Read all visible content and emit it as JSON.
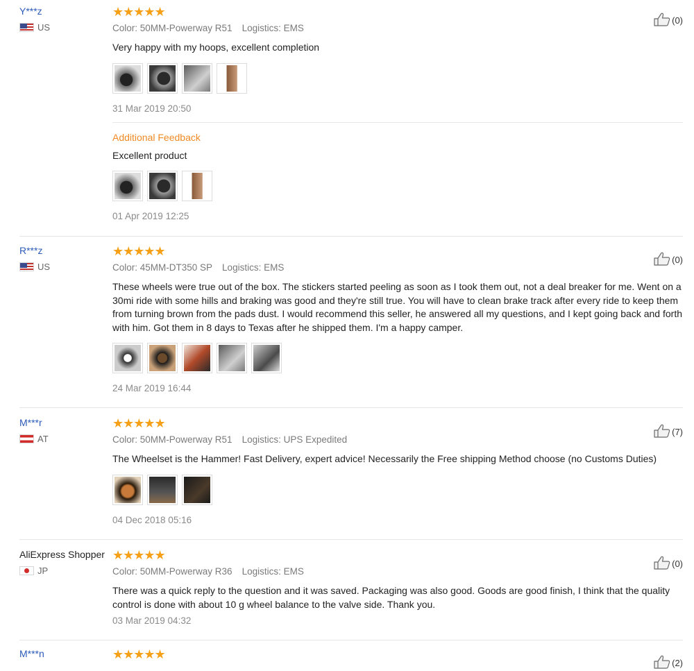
{
  "reviews": [
    {
      "user": "Y***z",
      "country": "US",
      "flag": "us",
      "stars": "★★★★★",
      "color": "Color: 50MM-Powerway R51",
      "logistics": "Logistics: EMS",
      "text": "Very happy with my hoops, excellent completion",
      "photos": [
        "ph1",
        "ph2",
        "ph3",
        "ph4"
      ],
      "date": "31 Mar 2019 20:50",
      "helpful": "(0)",
      "additional": {
        "label": "Additional Feedback",
        "text": "Excellent product",
        "photos": [
          "ph1",
          "ph2",
          "ph4"
        ],
        "date": "01 Apr 2019 12:25"
      }
    },
    {
      "user": "R***z",
      "country": "US",
      "flag": "us",
      "stars": "★★★★★",
      "color": "Color: 45MM-DT350 SP",
      "logistics": "Logistics: EMS",
      "text": "These wheels were true out of the box. The stickers started peeling as soon as I took them out, not a deal breaker for me. Went on a 30mi ride with some hills and braking was good and they're still true. You will have to clean brake track after every ride to keep them from turning brown from the pads dust. I would recommend this seller, he answered all my questions, and I kept going back and forth with him. Got them in 8 days to Texas after he shipped them. I'm a happy camper.",
      "photos": [
        "ph5",
        "ph6",
        "ph7",
        "ph3",
        "ph8"
      ],
      "date": "24 Mar 2019 16:44",
      "helpful": "(0)"
    },
    {
      "user": "M***r",
      "country": "AT",
      "flag": "at",
      "stars": "★★★★★",
      "color": "Color: 50MM-Powerway R51",
      "logistics": "Logistics: UPS Expedited",
      "text": "The Wheelset is the Hammer! Fast Delivery, expert advice! Necessarily the Free shipping Method choose (no Customs Duties)",
      "photos": [
        "ph9",
        "ph10",
        "ph11"
      ],
      "date": "04 Dec 2018 05:16",
      "helpful": "(7)"
    },
    {
      "user": "AliExpress Shopper",
      "country": "JP",
      "flag": "jp",
      "stars": "★★★★★",
      "color": "Color: 50MM-Powerway R36",
      "logistics": "Logistics: EMS",
      "text": "There was a quick reply to the question and it was saved. Packaging was also good. Goods are good finish, I think that the quality control is done with about 10 g wheel balance to the valve side. Thank you.",
      "photos": [],
      "date": "03 Mar 2019 04:32",
      "helpful": "(0)"
    },
    {
      "user": "M***n",
      "country": "",
      "flag": "",
      "stars": "★★★★★",
      "color": "",
      "logistics": "",
      "text": "",
      "photos": [],
      "date": "",
      "helpful": "(2)"
    }
  ]
}
